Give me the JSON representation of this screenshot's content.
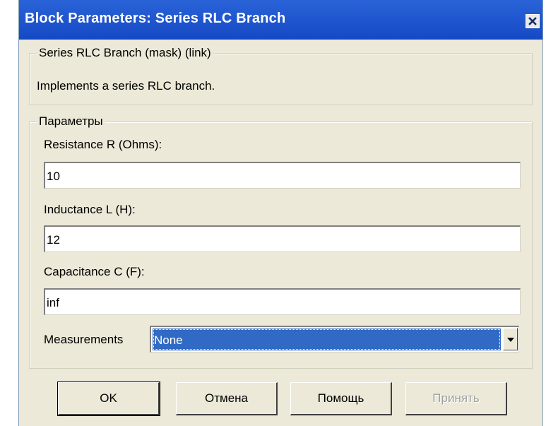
{
  "window": {
    "title": "Block Parameters: Series RLC Branch"
  },
  "mask_group": {
    "legend": "Series RLC Branch (mask) (link)",
    "description": "Implements a series RLC branch."
  },
  "params_group": {
    "legend": "Параметры",
    "resistance": {
      "label": "Resistance R (Ohms):",
      "value": "10"
    },
    "inductance": {
      "label": "Inductance L (H):",
      "value": "12"
    },
    "capacitance": {
      "label": "Capacitance C (F):",
      "value": "inf"
    },
    "measurements": {
      "label": "Measurements",
      "selected": "None"
    }
  },
  "buttons": {
    "ok": "OK",
    "cancel": "Отмена",
    "help": "Помощь",
    "apply": "Принять"
  },
  "icons": {
    "close": "close-icon",
    "dropdown": "chevron-down-icon"
  },
  "colors": {
    "titlebar": "#1549c4",
    "dialog_bg": "#ece9d8",
    "selection": "#316ac5"
  }
}
